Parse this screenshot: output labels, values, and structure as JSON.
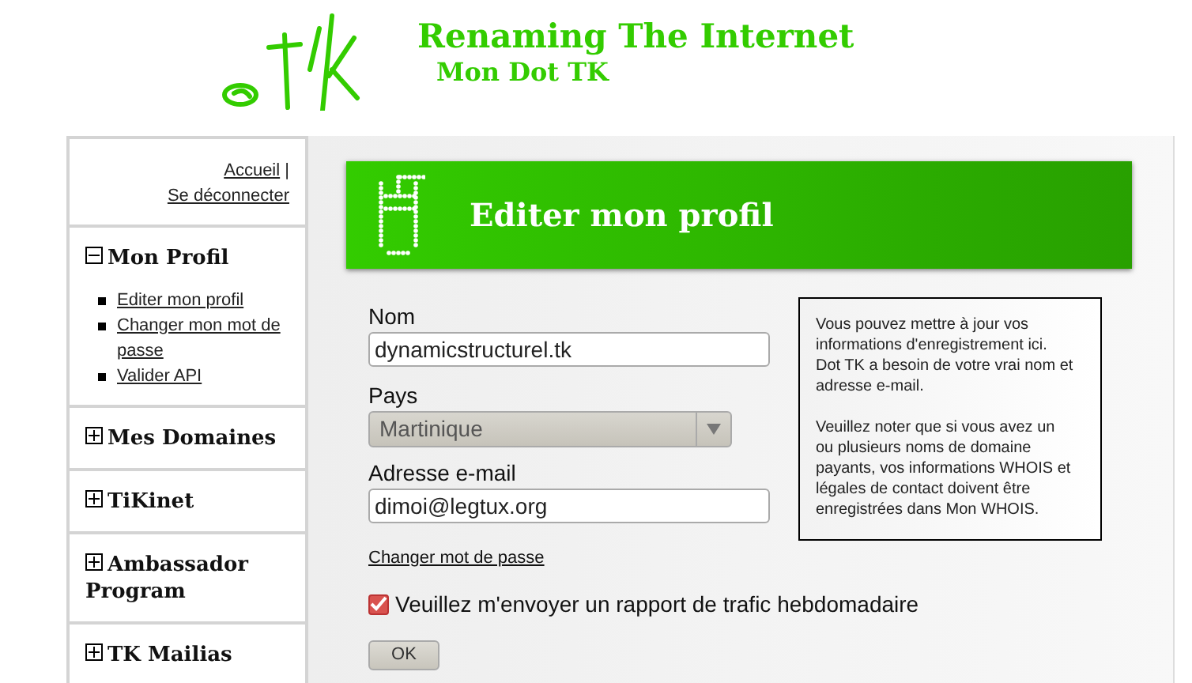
{
  "header": {
    "title": "Renaming The Internet",
    "subtitle": "Mon Dot TK"
  },
  "sidebar": {
    "top_links": [
      "Accueil",
      "Se déconnecter"
    ],
    "separator": "|",
    "sections": [
      {
        "title": "Mon Profil",
        "expanded": true,
        "items": [
          "Editer mon profil",
          "Changer mon mot de passe",
          "Valider API"
        ]
      },
      {
        "title": "Mes Domaines",
        "expanded": false
      },
      {
        "title": "TiKinet",
        "expanded": false
      },
      {
        "title": "Ambassador Program",
        "expanded": false
      },
      {
        "title": "TK Mailias",
        "expanded": false
      }
    ]
  },
  "banner": {
    "title": "Editer mon profil"
  },
  "form": {
    "name_label": "Nom",
    "name_value": "dynamicstructurel.tk",
    "country_label": "Pays",
    "country_value": "Martinique",
    "email_label": "Adresse e-mail",
    "email_value": "dimoi@legtux.org",
    "password_link": "Changer mot de passe",
    "report_checkbox": {
      "label": "Veuillez m'envoyer un rapport de trafic hebdomadaire",
      "checked": true
    },
    "ok_button": "OK"
  },
  "info_box": [
    "Vous pouvez mettre à jour vos informations d'enregistrement ici. Dot TK a besoin de votre vrai nom et adresse e-mail.",
    "Veuillez noter que si vous avez un ou plusieurs noms de domaine payants, vos informations WHOIS et légales de contact doivent être enregistrées dans Mon WHOIS."
  ]
}
